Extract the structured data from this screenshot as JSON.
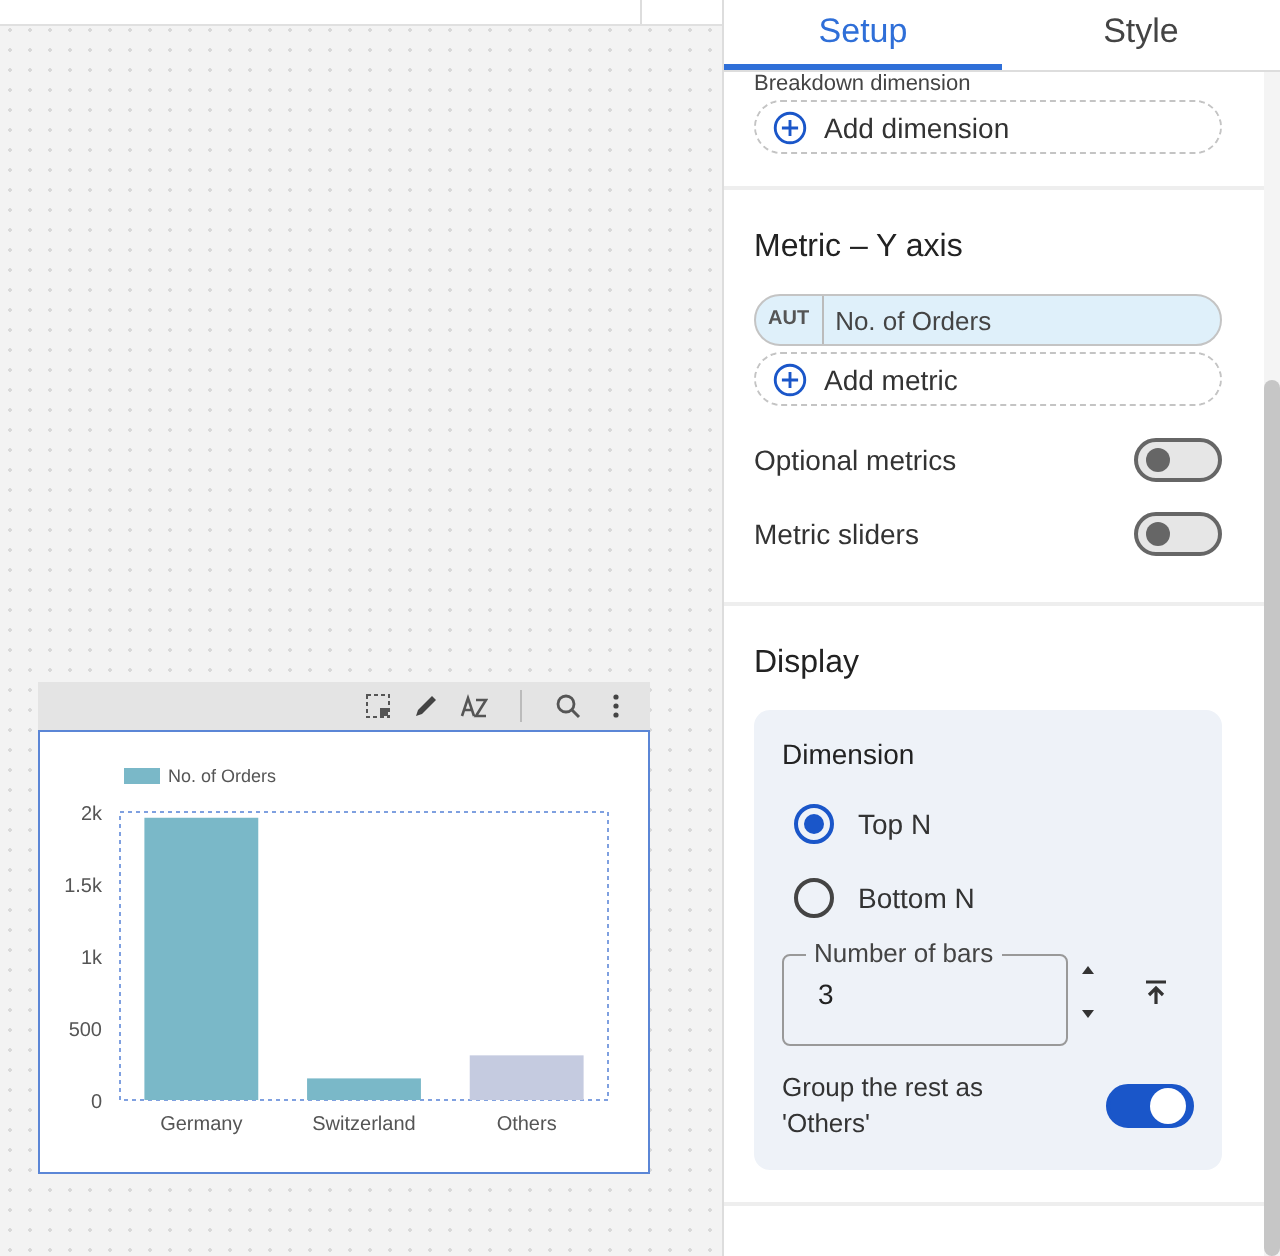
{
  "tabs": [
    {
      "label": "Setup",
      "selected": true
    },
    {
      "label": "Style",
      "selected": false
    }
  ],
  "chart_widget": {
    "chart_data": {
      "type": "bar",
      "categories": [
        "Germany",
        "Switzerland",
        "Others"
      ],
      "series": [
        {
          "name": "No. of Orders",
          "color": "#7ab8c8",
          "values": [
            1960,
            150,
            null
          ]
        },
        {
          "color": "#c5cbe0",
          "values": [
            null,
            null,
            310
          ]
        }
      ],
      "ylim": [
        0,
        2000
      ],
      "yticks": [
        {
          "value": 0,
          "label": "0"
        },
        {
          "value": 500,
          "label": "500"
        },
        {
          "value": 1000,
          "label": "1k"
        },
        {
          "value": 1500,
          "label": "1.5k"
        },
        {
          "value": 2000,
          "label": "2k"
        }
      ]
    }
  },
  "breakdown": {
    "label": "Breakdown dimension",
    "add_label": "Add dimension"
  },
  "metric": {
    "heading": "Metric – Y axis",
    "chip": {
      "badge": "AUT",
      "label": "No. of Orders"
    },
    "add_label": "Add metric",
    "toggles": [
      {
        "label": "Optional metrics",
        "on": false
      },
      {
        "label": "Metric sliders",
        "on": false
      }
    ]
  },
  "display": {
    "heading": "Display",
    "card_title": "Dimension",
    "options": [
      {
        "label": "Top N",
        "selected": true
      },
      {
        "label": "Bottom N",
        "selected": false
      }
    ],
    "field": {
      "label": "Number of bars",
      "value": "3"
    },
    "group_toggle": {
      "label": "Group the rest as 'Others'",
      "on": true
    }
  }
}
